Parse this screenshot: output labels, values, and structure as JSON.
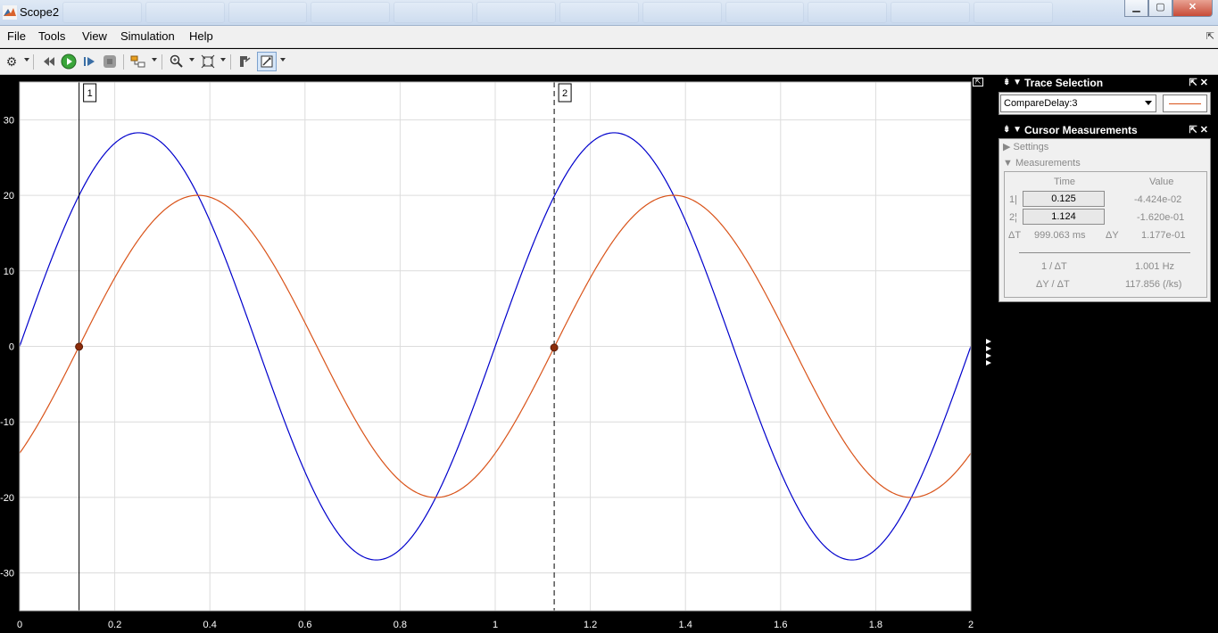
{
  "window": {
    "title": "Scope2",
    "controls": {
      "minimize": "▁",
      "maximize": "▢",
      "close": "✕"
    }
  },
  "menu": [
    "File",
    "Tools",
    "View",
    "Simulation",
    "Help"
  ],
  "toolbar": {
    "icons": [
      "gear-icon",
      "step-back-icon",
      "run-icon",
      "step-forward-icon",
      "stop-icon",
      "highlight-block-icon",
      "zoom-in-icon",
      "autoscale-icon",
      "cursor-style-icon",
      "data-cursors-icon"
    ]
  },
  "trace_selection": {
    "title": "Trace Selection",
    "selected": "CompareDelay:3",
    "swatch_color": "#d95319"
  },
  "cursor_measurements": {
    "title": "Cursor Measurements",
    "settings_label": "Settings",
    "measurements_label": "Measurements",
    "col_time": "Time",
    "col_value": "Value",
    "cursor1": {
      "label": "1",
      "time": "0.125",
      "value": "-4.424e-02"
    },
    "cursor2": {
      "label": "2",
      "time": "1.124",
      "value": "-1.620e-01"
    },
    "delta_t_label": "ΔT",
    "delta_t": "999.063 ms",
    "delta_y_label": "ΔY",
    "delta_y": "1.177e-01",
    "inv_dt_label": "1 / ΔT",
    "inv_dt": "1.001 Hz",
    "dy_dt_label": "ΔY / ΔT",
    "dy_dt": "117.856 (/ks)"
  },
  "chart_data": {
    "type": "line",
    "xlim": [
      0,
      2
    ],
    "ylim": [
      -35,
      35
    ],
    "xticks": [
      0,
      0.2,
      0.4,
      0.6,
      0.8,
      1,
      1.2,
      1.4,
      1.6,
      1.8,
      2
    ],
    "xtick_labels": [
      "0",
      "0.2",
      "0.4",
      "0.6",
      "0.8",
      "1",
      "1.2",
      "1.4",
      "1.6",
      "1.8",
      "2"
    ],
    "yticks": [
      30,
      20,
      10,
      0,
      -10,
      -20,
      -30
    ],
    "ytick_labels": [
      "30",
      "20",
      "10",
      "0",
      "-10",
      "-20",
      "-30"
    ],
    "grid": true,
    "series": [
      {
        "color": "#0000cc",
        "amplitude": 28.28,
        "period": 1,
        "phase_deg": 0
      },
      {
        "color": "#d95319",
        "amplitude": 20,
        "period": 1,
        "phase_deg": -45
      }
    ],
    "cursors": [
      {
        "label": "1",
        "x": 0.125,
        "y": -0.04424,
        "style": "solid"
      },
      {
        "label": "2",
        "x": 1.124,
        "y": -0.162,
        "style": "dashed"
      }
    ]
  }
}
